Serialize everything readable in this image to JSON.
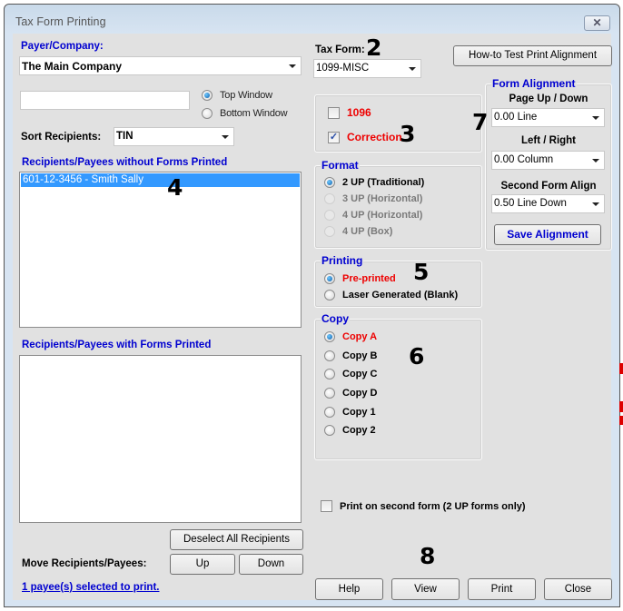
{
  "window": {
    "title": "Tax Form Printing",
    "close_icon": "close-x-icon"
  },
  "payer": {
    "label": "Payer/Company:",
    "value": "The Main Company"
  },
  "search": {
    "value": "",
    "window_options": [
      {
        "label": "Top Window",
        "selected": true
      },
      {
        "label": "Bottom Window",
        "selected": false
      }
    ]
  },
  "sort": {
    "label": "Sort Recipients:",
    "value": "TIN"
  },
  "unprinted": {
    "label": "Recipients/Payees without Forms Printed",
    "items": [
      {
        "text": "601-12-3456 - Smith  Sally",
        "selected": true
      }
    ]
  },
  "printed": {
    "label": "Recipients/Payees with Forms Printed",
    "items": []
  },
  "move": {
    "deselect_label": "Deselect All Recipients",
    "label": "Move Recipients/Payees:",
    "up_label": "Up",
    "down_label": "Down"
  },
  "status": {
    "selected_text": "1 payee(s) selected to print."
  },
  "tax_form": {
    "label": "Tax Form:",
    "value": "1099-MISC"
  },
  "howto_button": "How-to Test Print  Alignment",
  "options": {
    "form1096": {
      "label": "1096",
      "checked": false
    },
    "correction": {
      "label": "Correction",
      "checked": true
    }
  },
  "format": {
    "title": "Format",
    "options": [
      {
        "label": "2 UP (Traditional)",
        "selected": true,
        "enabled": true
      },
      {
        "label": "3 UP (Horizontal)",
        "selected": false,
        "enabled": false
      },
      {
        "label": "4 UP (Horizontal)",
        "selected": false,
        "enabled": false
      },
      {
        "label": "4 UP (Box)",
        "selected": false,
        "enabled": false
      }
    ]
  },
  "printing": {
    "title": "Printing",
    "options": [
      {
        "label": "Pre-printed",
        "selected": true
      },
      {
        "label": "Laser Generated (Blank)",
        "selected": false
      }
    ]
  },
  "copy": {
    "title": "Copy",
    "options": [
      {
        "label": "Copy A",
        "selected": true
      },
      {
        "label": "Copy B",
        "selected": false
      },
      {
        "label": "Copy C",
        "selected": false
      },
      {
        "label": "Copy D",
        "selected": false
      },
      {
        "label": "Copy 1",
        "selected": false
      },
      {
        "label": "Copy 2",
        "selected": false
      }
    ]
  },
  "alignment": {
    "title": "Form Alignment",
    "page_label": "Page Up / Down",
    "page_value": "0.00 Line",
    "lr_label": "Left / Right",
    "lr_value": "0.00 Column",
    "second_label": "Second Form Align",
    "second_value": "0.50 Line Down",
    "save_label": "Save  Alignment"
  },
  "second_form": {
    "label": "Print on second form (2 UP forms only)",
    "checked": false
  },
  "footer": {
    "help": "Help",
    "view": "View",
    "print": "Print",
    "close": "Close"
  },
  "callouts": [
    "2",
    "3",
    "4",
    "5",
    "6",
    "7",
    "8"
  ],
  "colors": {
    "label_blue": "#0000d0",
    "alert_red": "#ee0000",
    "selection_blue": "#3399ff",
    "panel_bg": "#e1e1e1"
  }
}
